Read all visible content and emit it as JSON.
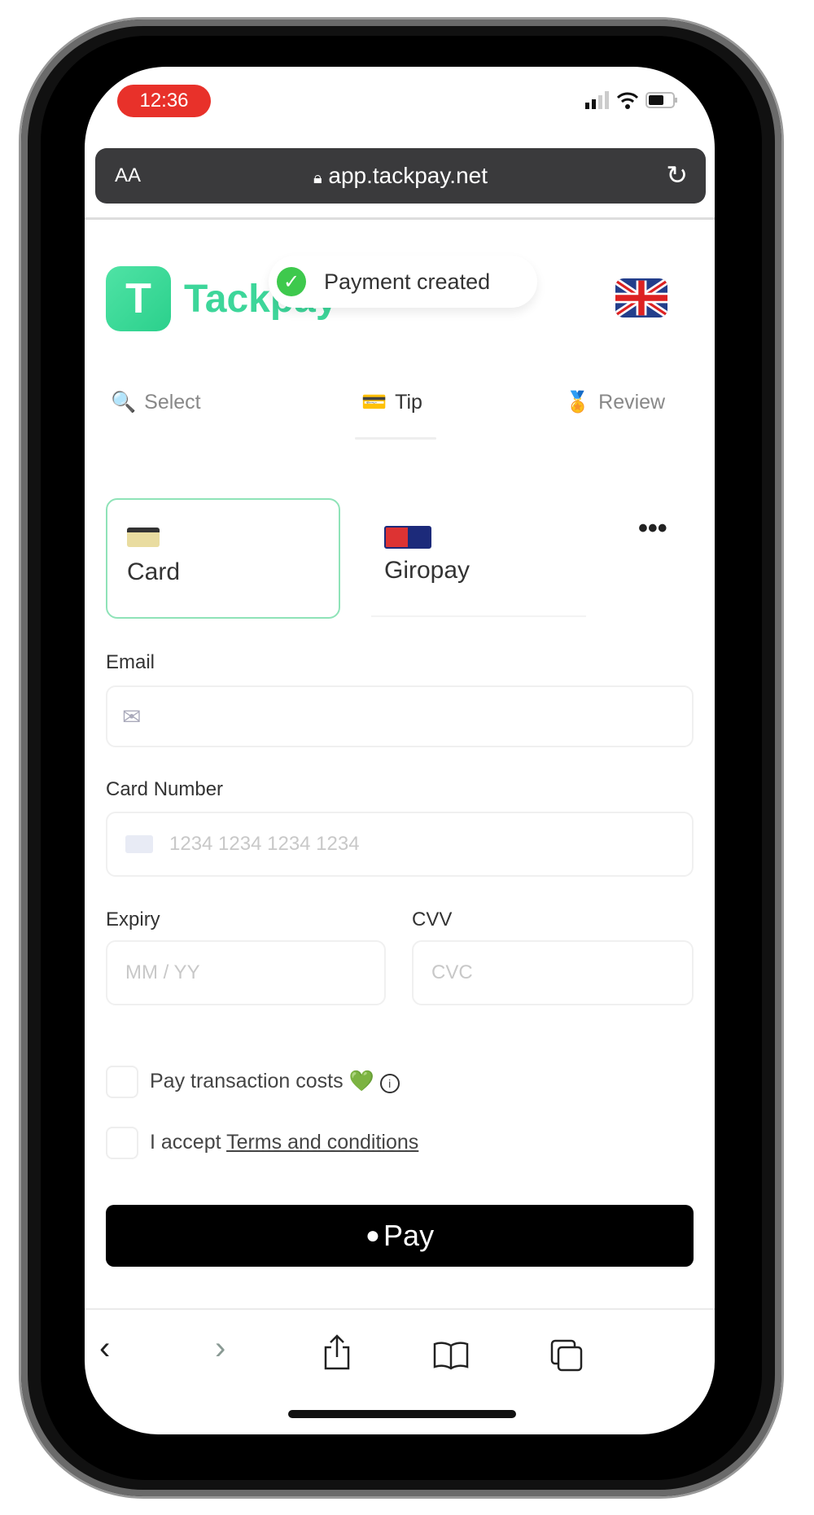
{
  "status_bar": {
    "time": "12:36",
    "signal_icon": "signal-icon",
    "wifi_icon": "wifi-icon",
    "battery_icon": "battery-icon"
  },
  "browser": {
    "text_size": "AA",
    "url": "app.tackpay.net",
    "lock_icon": "lock-icon",
    "reload_icon": "reload-icon"
  },
  "header": {
    "brand": "Tackpay",
    "toast": "Payment created",
    "language_flag": "uk-flag-icon"
  },
  "steps": [
    {
      "label": "Select",
      "icon": "🔍"
    },
    {
      "label": "Tip",
      "icon": "💳"
    },
    {
      "label": "Review",
      "icon": "🏅"
    }
  ],
  "payment_methods": [
    {
      "label": "Card",
      "selected": true
    },
    {
      "label": "Giropay",
      "selected": false
    }
  ],
  "more_label": "•••",
  "form": {
    "email_label": "Email",
    "email_placeholder": "",
    "card_number_label": "Card Number",
    "card_number_placeholder": "1234 1234 1234 1234",
    "expiry_label": "Expiry",
    "expiry_placeholder": "MM / YY",
    "cvv_label": "CVV",
    "cvv_placeholder": "CVC",
    "pay_costs_label": "Pay transaction costs",
    "pay_costs_emoji": "💚",
    "accept_prefix": "I accept",
    "terms_link": "Terms and conditions",
    "apple_pay_label": "Pay"
  },
  "colors": {
    "accent": "#3dd69a",
    "time_pill": "#e8312a"
  }
}
